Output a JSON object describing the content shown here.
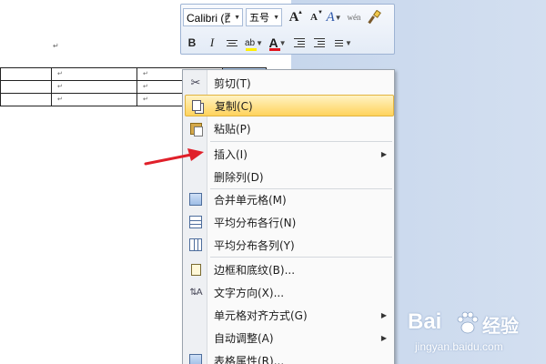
{
  "document": {
    "paragraph_mark": "↵",
    "table": {
      "rows": [
        [
          "↵",
          "↵",
          "↵",
          "↵"
        ],
        [
          "↵",
          "↵",
          "↵",
          "↵"
        ],
        [
          "↵",
          "↵",
          "↵",
          "↵"
        ]
      ]
    }
  },
  "mini_toolbar": {
    "font_name": "Calibri (西",
    "font_size": "五号",
    "grow_font": "A",
    "shrink_font": "A",
    "styles": "A",
    "phonetic": "wén",
    "bold": "B",
    "italic": "I",
    "highlight": "ab",
    "font_color": "A",
    "colors": {
      "highlight": "#ffef00",
      "font_color": "#e0121c"
    }
  },
  "context_menu": {
    "items": [
      {
        "label": "剪切(T)",
        "icon": "scissors-icon",
        "highlighted": false
      },
      {
        "label": "复制(C)",
        "icon": "copy-icon",
        "highlighted": true
      },
      {
        "label": "粘贴(P)",
        "icon": "paste-icon",
        "highlighted": false
      },
      {
        "label": "插入(I)",
        "icon": "",
        "submenu": true,
        "highlighted": false
      },
      {
        "label": "删除列(D)",
        "icon": "",
        "highlighted": false
      },
      {
        "label": "合并单元格(M)",
        "icon": "merge-cells-icon",
        "highlighted": false
      },
      {
        "label": "平均分布各行(N)",
        "icon": "distribute-rows-icon",
        "highlighted": false
      },
      {
        "label": "平均分布各列(Y)",
        "icon": "distribute-columns-icon",
        "highlighted": false
      },
      {
        "label": "边框和底纹(B)...",
        "icon": "borders-icon",
        "highlighted": false
      },
      {
        "label": "文字方向(X)...",
        "icon": "text-direction-icon",
        "highlighted": false
      },
      {
        "label": "单元格对齐方式(G)",
        "icon": "",
        "submenu": true,
        "highlighted": false
      },
      {
        "label": "自动调整(A)",
        "icon": "",
        "submenu": true,
        "highlighted": false
      },
      {
        "label": "表格属性(R)...",
        "icon": "table-properties-icon",
        "highlighted": false
      }
    ],
    "submenu_arrow": "▶"
  },
  "watermark": {
    "brand": "Bai",
    "cn": "经验",
    "url": "jingyan.baidu.com"
  },
  "colors": {
    "arrow": "#e0202a",
    "menu_highlight": "#ffd35c"
  }
}
